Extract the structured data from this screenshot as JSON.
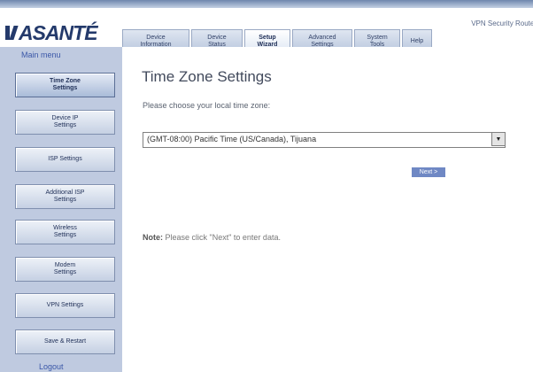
{
  "header": {
    "logo_text": "ASANTÉ",
    "product_name": "VPN Security Router"
  },
  "tabs": [
    {
      "label": "Device\nInformation",
      "active": false
    },
    {
      "label": "Device\nStatus",
      "active": false
    },
    {
      "label": "Setup\nWizard",
      "active": true
    },
    {
      "label": "Advanced\nSettings",
      "active": false
    },
    {
      "label": "System\nTools",
      "active": false
    },
    {
      "label": "Help",
      "active": false
    }
  ],
  "sidebar": {
    "title": "Main menu",
    "items": [
      {
        "label": "Time Zone\nSettings",
        "active": true
      },
      {
        "label": "Device IP\nSettings",
        "active": false
      },
      {
        "label": "ISP Settings",
        "active": false
      },
      {
        "label": "Additional ISP\nSettings",
        "active": false
      },
      {
        "label": "Wireless\nSettings",
        "active": false
      },
      {
        "label": "Modem\nSettings",
        "active": false
      },
      {
        "label": "VPN Settings",
        "active": false
      },
      {
        "label": "Save & Restart",
        "active": false
      }
    ],
    "logout": "Logout"
  },
  "main": {
    "title": "Time Zone Settings",
    "prompt": "Please choose your local time zone:",
    "timezone_selected": "(GMT-08:00) Pacific Time (US/Canada), Tijuana",
    "next_button": "Next >",
    "note_label": "Note:",
    "note_text": " Please click \"Next\" to enter data."
  },
  "icons": {
    "logo": "asante-logo-mark",
    "dropdown": "chevron-down-icon"
  },
  "colors": {
    "sidebar_bg": "#bfcae0",
    "accent": "#3a57a8",
    "logo": "#243a6b",
    "button": "#6f88c4"
  }
}
